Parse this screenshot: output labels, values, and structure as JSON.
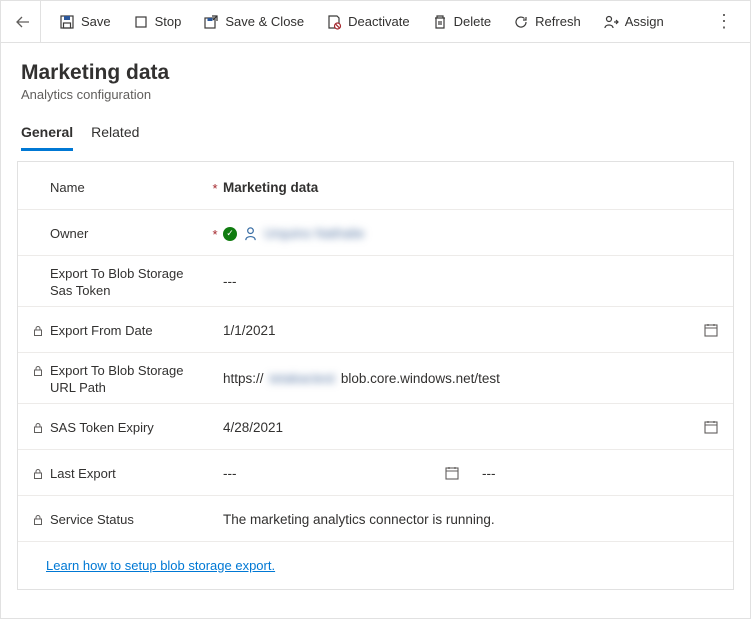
{
  "toolbar": {
    "save": "Save",
    "stop": "Stop",
    "save_close": "Save & Close",
    "deactivate": "Deactivate",
    "delete": "Delete",
    "refresh": "Refresh",
    "assign": "Assign"
  },
  "header": {
    "title": "Marketing data",
    "subtitle": "Analytics configuration"
  },
  "tabs": {
    "general": "General",
    "related": "Related"
  },
  "fields": {
    "name": {
      "label": "Name",
      "value": "Marketing data"
    },
    "owner": {
      "label": "Owner",
      "value": "Urquino Nathalie"
    },
    "sas_token": {
      "label": "Export To Blob Storage Sas Token",
      "value": "---"
    },
    "from_date": {
      "label": "Export From Date",
      "value": "1/1/2021"
    },
    "url_path": {
      "label": "Export To Blob Storage URL Path",
      "prefix": "https://",
      "masked": "tetakactest",
      "suffix": "blob.core.windows.net/test"
    },
    "expiry": {
      "label": "SAS Token Expiry",
      "value": "4/28/2021"
    },
    "last_export": {
      "label": "Last Export",
      "value_date": "---",
      "value_time": "---"
    },
    "service_status": {
      "label": "Service Status",
      "value": "The marketing analytics connector is running."
    }
  },
  "footer": {
    "link": "Learn how to setup blob storage export."
  }
}
